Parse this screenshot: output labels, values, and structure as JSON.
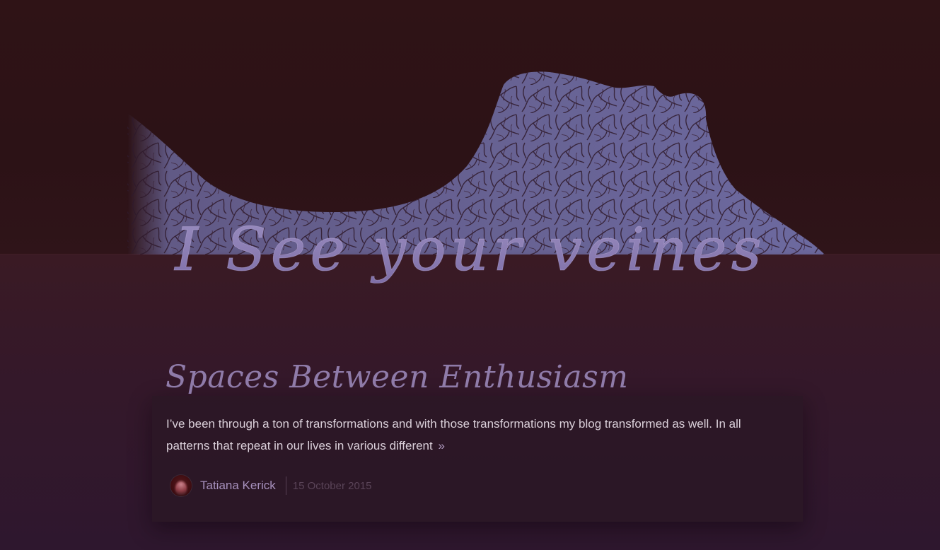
{
  "site": {
    "logo_text": "I See your veines"
  },
  "post": {
    "title": "Spaces Between Enthusiasm",
    "excerpt": "I’ve been through a ton of transformations and with those transformations my blog transformed as well. In all patterns that repeat in our lives in various different",
    "read_more": "»",
    "author": "Tatiana Kerick",
    "date": "15 October 2015"
  },
  "colors": {
    "background": "#2e1318",
    "accent": "#8f7ba9",
    "text": "#dbd0da",
    "muted": "#5a4458"
  }
}
